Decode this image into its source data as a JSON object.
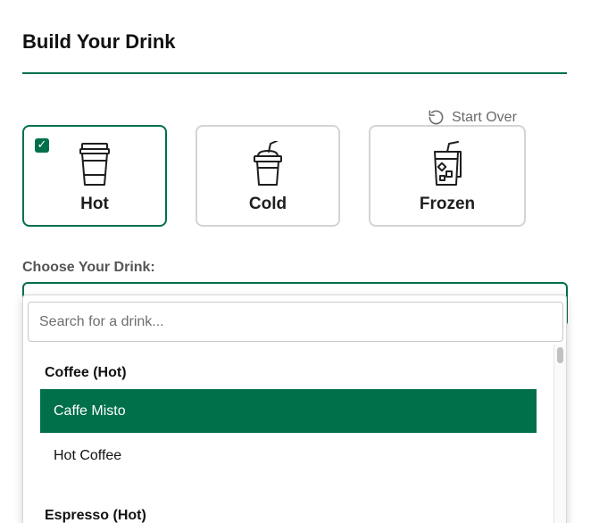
{
  "page": {
    "title": "Build Your Drink"
  },
  "start_over": {
    "label": "Start Over",
    "icon": "rotate-ccw-icon"
  },
  "temperatures": [
    {
      "label": "Hot",
      "icon": "hot-cup-icon",
      "selected": true
    },
    {
      "label": "Cold",
      "icon": "cold-cup-icon",
      "selected": false
    },
    {
      "label": "Frozen",
      "icon": "frozen-cup-icon",
      "selected": false
    }
  ],
  "choose": {
    "label": "Choose Your Drink:"
  },
  "dropdown": {
    "search_placeholder": "Search for a drink...",
    "search_value": "",
    "groups": [
      {
        "header": "Coffee (Hot)",
        "options": [
          {
            "label": "Caffe Misto",
            "active": true
          },
          {
            "label": "Hot Coffee",
            "active": false
          }
        ]
      },
      {
        "header": "Espresso (Hot)",
        "options": []
      }
    ]
  },
  "colors": {
    "accent": "#00704a",
    "border": "#d4d4d4",
    "muted_text": "#6b6b6b"
  },
  "selected_check": "✓"
}
